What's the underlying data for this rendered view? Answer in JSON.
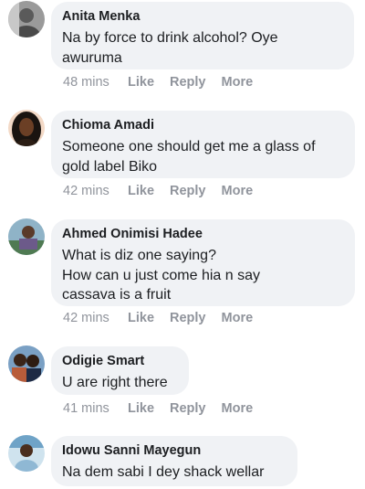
{
  "comments": [
    {
      "author": "Anita Menka",
      "text": "Na by force to drink alcohol? Oye\nawuruma",
      "time": "48 mins",
      "avatar": "avatar-anita-menka"
    },
    {
      "author": "Chioma Amadi",
      "text": "Someone one should get me a glass of\ngold label Biko",
      "time": "42 mins",
      "avatar": "avatar-chioma-amadi"
    },
    {
      "author": "Ahmed Onimisi Hadee",
      "text": "What is diz one saying?\nHow can u just come hia n say\ncassava is a fruit",
      "time": "42 mins",
      "avatar": "avatar-ahmed-onimisi-hadee"
    },
    {
      "author": "Odigie Smart",
      "text": "U are right there",
      "time": "41 mins",
      "avatar": "avatar-odigie-smart"
    },
    {
      "author": "Idowu Sanni Mayegun",
      "text": "Na dem sabi I dey shack wellar",
      "avatar": "avatar-idowu-sanni-mayegun"
    }
  ],
  "actions": {
    "like": "Like",
    "reply": "Reply",
    "more": "More"
  },
  "colors": {
    "bubble": "#f0f2f5",
    "meta": "#90949c",
    "text": "#1c1e21"
  }
}
